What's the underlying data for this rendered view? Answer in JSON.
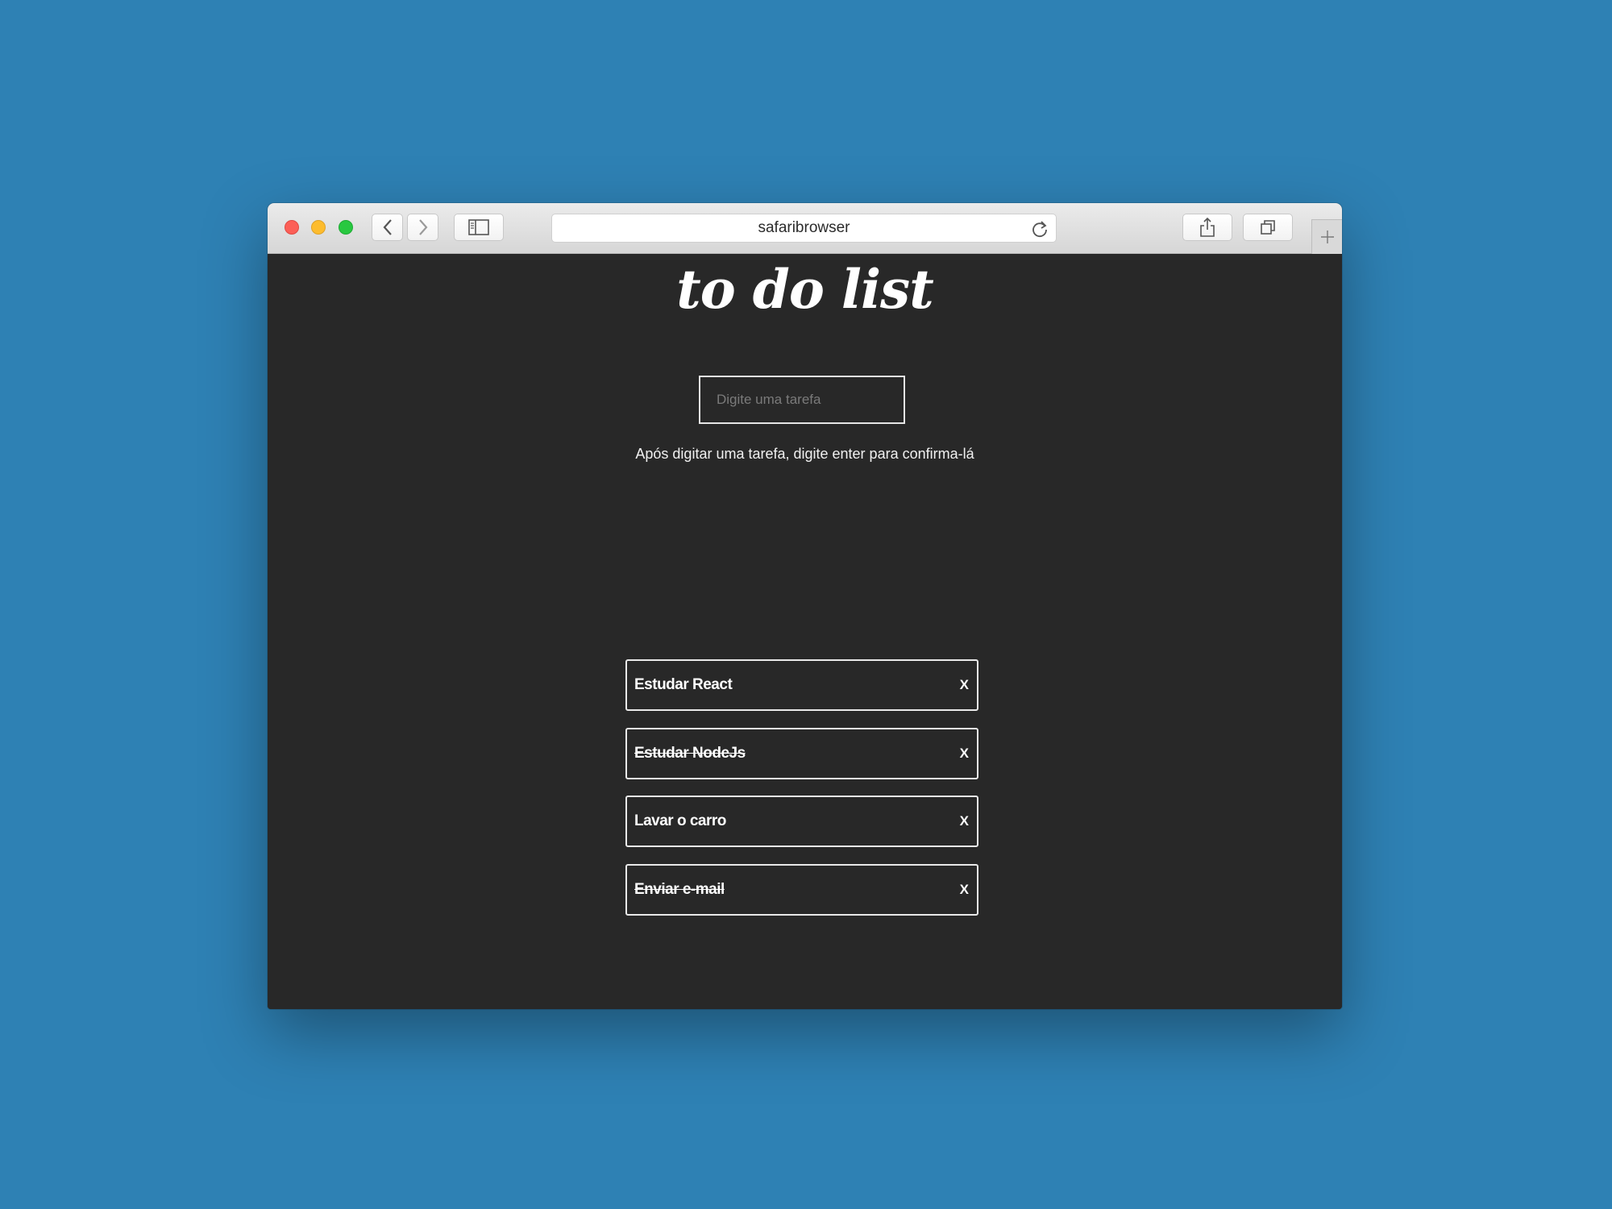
{
  "browser": {
    "address": "safaribrowser"
  },
  "app": {
    "title": "to do list",
    "input_placeholder": "Digite uma tarefa",
    "input_value": "",
    "hint": "Após digitar uma tarefa, digite enter para confirma-lá"
  },
  "tasks": [
    {
      "label": "Estudar React",
      "completed": false,
      "remove": "X"
    },
    {
      "label": "Estudar NodeJs",
      "completed": true,
      "remove": "X"
    },
    {
      "label": "Lavar o carro",
      "completed": false,
      "remove": "X"
    },
    {
      "label": "Enviar e-mail",
      "completed": true,
      "remove": "X"
    }
  ],
  "colors": {
    "desktop": "#2e81b4",
    "page_background": "#282828",
    "text": "#ffffff"
  }
}
